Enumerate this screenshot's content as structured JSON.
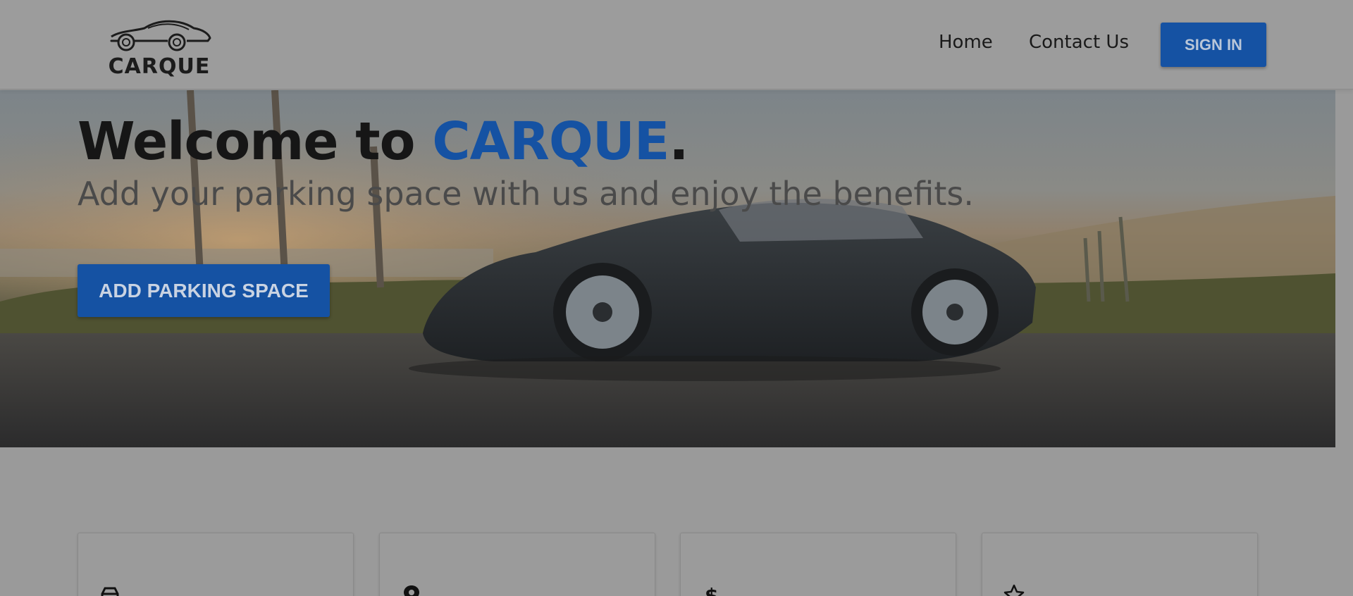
{
  "header": {
    "logo_text": "CARQUE",
    "nav": [
      "Home",
      "Contact Us"
    ],
    "signin_label": "SIGN IN"
  },
  "hero": {
    "title_prefix": "Welcome to ",
    "title_brand": "CARQUE",
    "title_suffix": ".",
    "subtitle": "Add your parking space with us and enjoy the benefits.",
    "cta_label": "ADD PARKING SPACE"
  },
  "features": [
    {
      "icon": "car-icon"
    },
    {
      "icon": "map-pin-icon"
    },
    {
      "icon": "dollar-icon"
    },
    {
      "icon": "star-icon"
    }
  ],
  "colors": {
    "brand_blue": "#1552a3",
    "title_text": "#161616",
    "subtitle_text": "#4a4a4a",
    "page_bg": "#9a9a9a"
  }
}
